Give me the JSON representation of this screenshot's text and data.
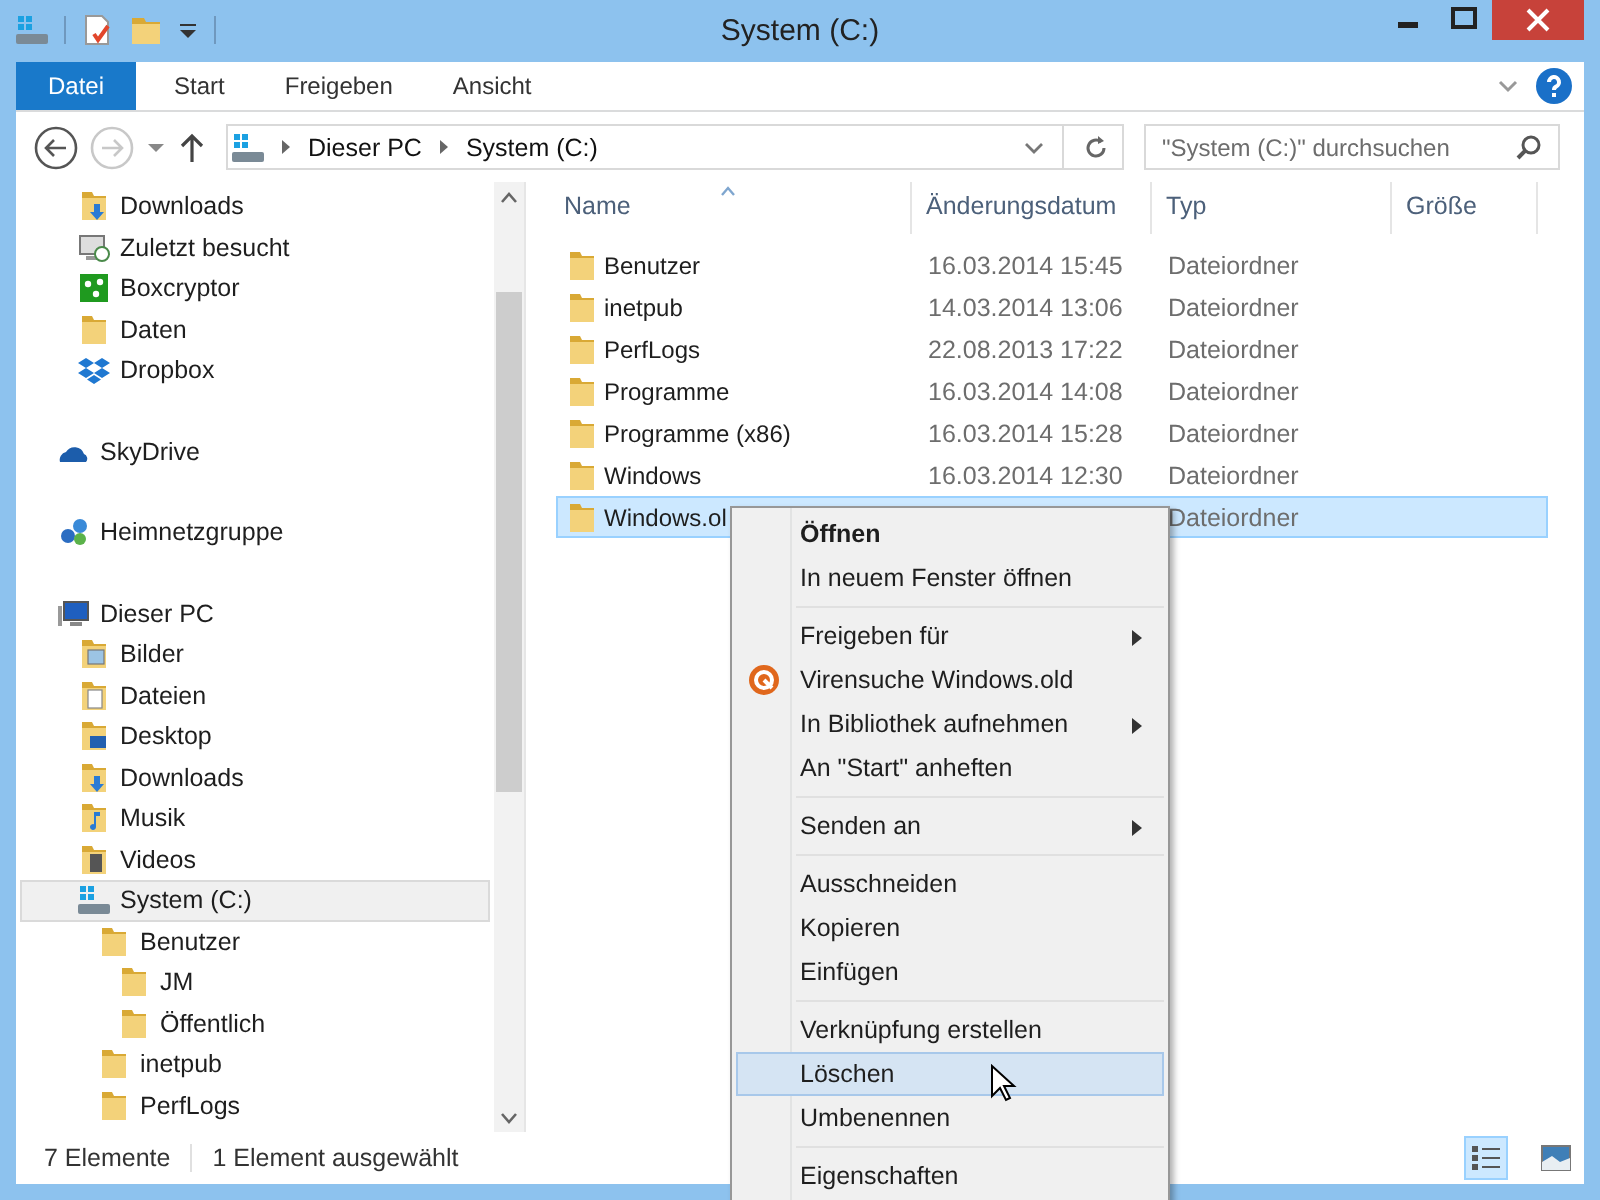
{
  "window": {
    "title": "System (C:)"
  },
  "ribbon": {
    "tabs": [
      {
        "label": "Datei",
        "kind": "file"
      },
      {
        "label": "Start",
        "kind": "tab"
      },
      {
        "label": "Freigeben",
        "kind": "tab"
      },
      {
        "label": "Ansicht",
        "kind": "tab"
      }
    ]
  },
  "navigation": {
    "back_disabled": false,
    "forward_disabled": true
  },
  "address": {
    "path": [
      "Dieser PC",
      "System (C:)"
    ]
  },
  "search": {
    "placeholder": "\"System (C:)\" durchsuchen"
  },
  "sidebar": {
    "tree": [
      {
        "children": [
          {
            "label": "Downloads",
            "kind": "download-folder",
            "selected": false
          },
          {
            "label": "Zuletzt besucht",
            "kind": "recent",
            "selected": false
          },
          {
            "label": "Boxcryptor",
            "kind": "boxcryptor",
            "selected": false
          },
          {
            "label": "Daten",
            "kind": "folder",
            "selected": false
          },
          {
            "label": "Dropbox",
            "kind": "dropbox",
            "selected": false
          }
        ]
      },
      {
        "label": "SkyDrive",
        "kind": "cloud",
        "selected": false
      },
      {
        "label": "Heimnetzgruppe",
        "kind": "homegroup",
        "selected": false
      },
      {
        "label": "Dieser PC",
        "kind": "pc",
        "selected": false,
        "children": [
          {
            "label": "Bilder",
            "kind": "pictures",
            "selected": false
          },
          {
            "label": "Dateien",
            "kind": "documents",
            "selected": false
          },
          {
            "label": "Desktop",
            "kind": "desktop",
            "selected": false
          },
          {
            "label": "Downloads",
            "kind": "download-folder",
            "selected": false
          },
          {
            "label": "Musik",
            "kind": "music",
            "selected": false
          },
          {
            "label": "Videos",
            "kind": "videos",
            "selected": false
          },
          {
            "label": "System (C:)",
            "kind": "drive",
            "selected": true,
            "children": [
              {
                "label": "Benutzer",
                "kind": "folder",
                "selected": false,
                "children": [
                  {
                    "label": "JM",
                    "kind": "folder",
                    "selected": false
                  },
                  {
                    "label": "Öffentlich",
                    "kind": "folder",
                    "selected": false
                  }
                ]
              },
              {
                "label": "inetpub",
                "kind": "folder",
                "selected": false
              },
              {
                "label": "PerfLogs",
                "kind": "folder",
                "selected": false
              }
            ]
          }
        ]
      }
    ]
  },
  "file_list": {
    "columns": [
      "Name",
      "Änderungsdatum",
      "Typ",
      "Größe"
    ],
    "rows": [
      {
        "name": "Benutzer",
        "date": "16.03.2014 15:45",
        "type": "Dateiordner",
        "selected": false
      },
      {
        "name": "inetpub",
        "date": "14.03.2014 13:06",
        "type": "Dateiordner",
        "selected": false
      },
      {
        "name": "PerfLogs",
        "date": "22.08.2013 17:22",
        "type": "Dateiordner",
        "selected": false
      },
      {
        "name": "Programme",
        "date": "16.03.2014 14:08",
        "type": "Dateiordner",
        "selected": false
      },
      {
        "name": "Programme (x86)",
        "date": "16.03.2014 15:28",
        "type": "Dateiordner",
        "selected": false
      },
      {
        "name": "Windows",
        "date": "16.03.2014 12:30",
        "type": "Dateiordner",
        "selected": false
      },
      {
        "name": "Windows.ol",
        "type": "Dateiordner",
        "selected": true
      }
    ]
  },
  "context_menu": {
    "items": [
      {
        "kind": "command",
        "label": "Öffnen",
        "default": true,
        "submenu": false,
        "selected": false
      },
      {
        "kind": "command",
        "label": "In neuem Fenster öffnen",
        "default": false,
        "submenu": false,
        "selected": false
      },
      {
        "kind": "separator"
      },
      {
        "kind": "command",
        "label": "Freigeben für",
        "default": false,
        "submenu": true,
        "selected": false
      },
      {
        "kind": "antivirus",
        "label": "Virensuche Windows.old",
        "default": false,
        "submenu": false,
        "selected": false
      },
      {
        "kind": "command",
        "label": "In Bibliothek aufnehmen",
        "default": false,
        "submenu": true,
        "selected": false
      },
      {
        "kind": "command",
        "label": "An \"Start\" anheften",
        "default": false,
        "submenu": false,
        "selected": false
      },
      {
        "kind": "separator"
      },
      {
        "kind": "command",
        "label": "Senden an",
        "default": false,
        "submenu": true,
        "selected": false
      },
      {
        "kind": "separator"
      },
      {
        "kind": "command",
        "label": "Ausschneiden",
        "default": false,
        "submenu": false,
        "selected": false
      },
      {
        "kind": "command",
        "label": "Kopieren",
        "default": false,
        "submenu": false,
        "selected": false
      },
      {
        "kind": "command",
        "label": "Einfügen",
        "default": false,
        "submenu": false,
        "selected": false
      },
      {
        "kind": "separator"
      },
      {
        "kind": "command",
        "label": "Verknüpfung erstellen",
        "default": false,
        "submenu": false,
        "selected": false
      },
      {
        "kind": "command",
        "label": "Löschen",
        "default": false,
        "submenu": false,
        "selected": true
      },
      {
        "kind": "command",
        "label": "Umbenennen",
        "default": false,
        "submenu": false,
        "selected": false
      },
      {
        "kind": "separator"
      },
      {
        "kind": "command",
        "label": "Eigenschaften",
        "default": false,
        "submenu": false,
        "selected": false
      }
    ]
  },
  "status_bar": {
    "count": "7 Elemente",
    "selection": "1 Element ausgewählt",
    "views": [
      {
        "kind": "details",
        "selected": true
      },
      {
        "kind": "large-icons",
        "selected": false
      }
    ]
  }
}
